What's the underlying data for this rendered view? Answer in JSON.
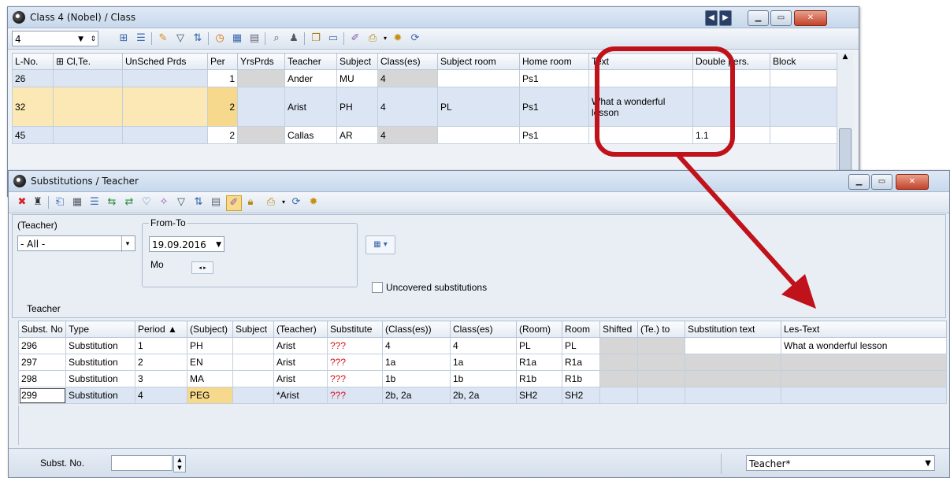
{
  "class_window": {
    "title": "Class 4 (Nobel) / Class",
    "selector_value": "4",
    "columns": [
      "L-No.",
      "⊞ Cl,Te.",
      "UnSched Prds",
      "Per",
      "YrsPrds",
      "Teacher",
      "Subject",
      "Class(es)",
      "Subject room",
      "Home room",
      "Text",
      "Double pers.",
      "Block"
    ],
    "rows": [
      {
        "lno": "26",
        "per": "1",
        "teacher": "Ander",
        "subject": "MU",
        "classes": "4",
        "subject_room": "",
        "home_room": "Ps1",
        "text": "",
        "double": ""
      },
      {
        "lno": "32",
        "per": "2",
        "teacher": "Arist",
        "subject": "PH",
        "classes": "4",
        "subject_room": "PL",
        "home_room": "Ps1",
        "text": "What a wonderful lesson",
        "double": ""
      },
      {
        "lno": "45",
        "per": "2",
        "teacher": "Callas",
        "subject": "AR",
        "classes": "4",
        "subject_room": "",
        "home_room": "Ps1",
        "text": "",
        "double": "1.1"
      }
    ]
  },
  "subst_window": {
    "title": "Substitutions / Teacher",
    "teacher_label": "(Teacher)",
    "teacher_value": "- All -",
    "fromto_label": "From-To",
    "date_value": "19.09.2016",
    "day_label": "Mo",
    "uncovered_label": "Uncovered substitutions",
    "section_label": "Teacher",
    "columns": [
      "Subst. No",
      "Type",
      "Period ▲",
      "(Subject)",
      "Subject",
      "(Teacher)",
      "Substitute",
      "(Class(es))",
      "Class(es)",
      "(Room)",
      "Room",
      "Shifted",
      "(Te.) to",
      "Substitution text",
      "Les-Text"
    ],
    "rows": [
      {
        "no": "296",
        "type": "Substitution",
        "period": "1",
        "psubject": "PH",
        "subject": "",
        "pteacher": "Arist",
        "substitute": "???",
        "pclasses": "4",
        "classes": "4",
        "proom": "PL",
        "room": "PL",
        "shifted": "",
        "teto": "",
        "stext": "",
        "lestext": "What a wonderful lesson"
      },
      {
        "no": "297",
        "type": "Substitution",
        "period": "2",
        "psubject": "EN",
        "subject": "",
        "pteacher": "Arist",
        "substitute": "???",
        "pclasses": "1a",
        "classes": "1a",
        "proom": "R1a",
        "room": "R1a",
        "shifted": "",
        "teto": "",
        "stext": "",
        "lestext": ""
      },
      {
        "no": "298",
        "type": "Substitution",
        "period": "3",
        "psubject": "MA",
        "subject": "",
        "pteacher": "Arist",
        "substitute": "???",
        "pclasses": "1b",
        "classes": "1b",
        "proom": "R1b",
        "room": "R1b",
        "shifted": "",
        "teto": "",
        "stext": "",
        "lestext": ""
      },
      {
        "no": "299",
        "type": "Substitution",
        "period": "4",
        "psubject": "PEG",
        "subject": "",
        "pteacher": "*Arist",
        "substitute": "???",
        "pclasses": "2b, 2a",
        "classes": "2b, 2a",
        "proom": "SH2",
        "room": "SH2",
        "shifted": "",
        "teto": "",
        "stext": "",
        "lestext": ""
      }
    ],
    "status_label": "Subst. No.",
    "status_view": "Teacher*"
  },
  "colors": {
    "highlight_red": "#c0121a",
    "alert_text": "#d8141b"
  }
}
